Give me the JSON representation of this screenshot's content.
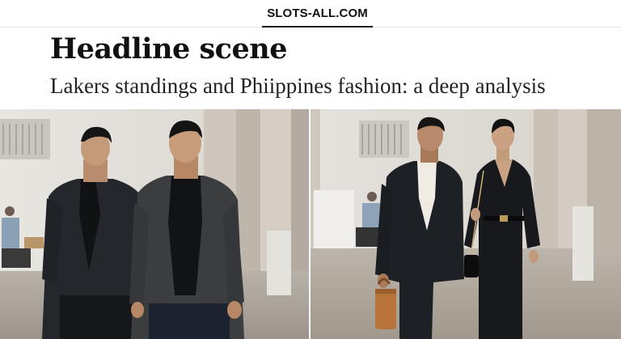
{
  "site": {
    "brand": "SLOTS-ALL.COM"
  },
  "article": {
    "headline": "Headline scene",
    "subheadline": "Lakers standings and Phiippines fashion: a deep analysis"
  },
  "images": [
    {
      "subject": "two-men-in-dark-blazers"
    },
    {
      "subject": "man-and-woman-in-black-suits-walking"
    }
  ]
}
